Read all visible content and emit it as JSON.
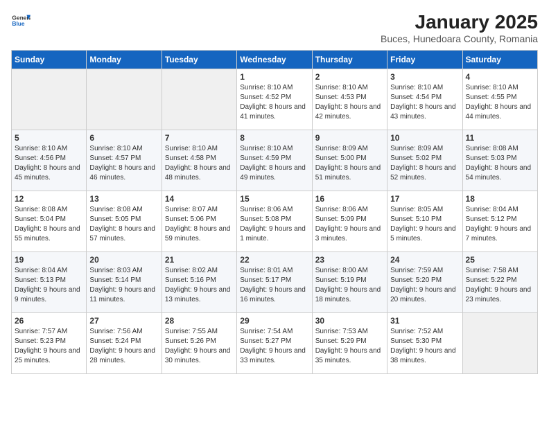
{
  "header": {
    "logo_general": "General",
    "logo_blue": "Blue",
    "title": "January 2025",
    "subtitle": "Buces, Hunedoara County, Romania"
  },
  "days_of_week": [
    "Sunday",
    "Monday",
    "Tuesday",
    "Wednesday",
    "Thursday",
    "Friday",
    "Saturday"
  ],
  "weeks": [
    [
      {
        "day": "",
        "sunrise": "",
        "sunset": "",
        "daylight": ""
      },
      {
        "day": "",
        "sunrise": "",
        "sunset": "",
        "daylight": ""
      },
      {
        "day": "",
        "sunrise": "",
        "sunset": "",
        "daylight": ""
      },
      {
        "day": "1",
        "sunrise": "Sunrise: 8:10 AM",
        "sunset": "Sunset: 4:52 PM",
        "daylight": "Daylight: 8 hours and 41 minutes."
      },
      {
        "day": "2",
        "sunrise": "Sunrise: 8:10 AM",
        "sunset": "Sunset: 4:53 PM",
        "daylight": "Daylight: 8 hours and 42 minutes."
      },
      {
        "day": "3",
        "sunrise": "Sunrise: 8:10 AM",
        "sunset": "Sunset: 4:54 PM",
        "daylight": "Daylight: 8 hours and 43 minutes."
      },
      {
        "day": "4",
        "sunrise": "Sunrise: 8:10 AM",
        "sunset": "Sunset: 4:55 PM",
        "daylight": "Daylight: 8 hours and 44 minutes."
      }
    ],
    [
      {
        "day": "5",
        "sunrise": "Sunrise: 8:10 AM",
        "sunset": "Sunset: 4:56 PM",
        "daylight": "Daylight: 8 hours and 45 minutes."
      },
      {
        "day": "6",
        "sunrise": "Sunrise: 8:10 AM",
        "sunset": "Sunset: 4:57 PM",
        "daylight": "Daylight: 8 hours and 46 minutes."
      },
      {
        "day": "7",
        "sunrise": "Sunrise: 8:10 AM",
        "sunset": "Sunset: 4:58 PM",
        "daylight": "Daylight: 8 hours and 48 minutes."
      },
      {
        "day": "8",
        "sunrise": "Sunrise: 8:10 AM",
        "sunset": "Sunset: 4:59 PM",
        "daylight": "Daylight: 8 hours and 49 minutes."
      },
      {
        "day": "9",
        "sunrise": "Sunrise: 8:09 AM",
        "sunset": "Sunset: 5:00 PM",
        "daylight": "Daylight: 8 hours and 51 minutes."
      },
      {
        "day": "10",
        "sunrise": "Sunrise: 8:09 AM",
        "sunset": "Sunset: 5:02 PM",
        "daylight": "Daylight: 8 hours and 52 minutes."
      },
      {
        "day": "11",
        "sunrise": "Sunrise: 8:08 AM",
        "sunset": "Sunset: 5:03 PM",
        "daylight": "Daylight: 8 hours and 54 minutes."
      }
    ],
    [
      {
        "day": "12",
        "sunrise": "Sunrise: 8:08 AM",
        "sunset": "Sunset: 5:04 PM",
        "daylight": "Daylight: 8 hours and 55 minutes."
      },
      {
        "day": "13",
        "sunrise": "Sunrise: 8:08 AM",
        "sunset": "Sunset: 5:05 PM",
        "daylight": "Daylight: 8 hours and 57 minutes."
      },
      {
        "day": "14",
        "sunrise": "Sunrise: 8:07 AM",
        "sunset": "Sunset: 5:06 PM",
        "daylight": "Daylight: 8 hours and 59 minutes."
      },
      {
        "day": "15",
        "sunrise": "Sunrise: 8:06 AM",
        "sunset": "Sunset: 5:08 PM",
        "daylight": "Daylight: 9 hours and 1 minute."
      },
      {
        "day": "16",
        "sunrise": "Sunrise: 8:06 AM",
        "sunset": "Sunset: 5:09 PM",
        "daylight": "Daylight: 9 hours and 3 minutes."
      },
      {
        "day": "17",
        "sunrise": "Sunrise: 8:05 AM",
        "sunset": "Sunset: 5:10 PM",
        "daylight": "Daylight: 9 hours and 5 minutes."
      },
      {
        "day": "18",
        "sunrise": "Sunrise: 8:04 AM",
        "sunset": "Sunset: 5:12 PM",
        "daylight": "Daylight: 9 hours and 7 minutes."
      }
    ],
    [
      {
        "day": "19",
        "sunrise": "Sunrise: 8:04 AM",
        "sunset": "Sunset: 5:13 PM",
        "daylight": "Daylight: 9 hours and 9 minutes."
      },
      {
        "day": "20",
        "sunrise": "Sunrise: 8:03 AM",
        "sunset": "Sunset: 5:14 PM",
        "daylight": "Daylight: 9 hours and 11 minutes."
      },
      {
        "day": "21",
        "sunrise": "Sunrise: 8:02 AM",
        "sunset": "Sunset: 5:16 PM",
        "daylight": "Daylight: 9 hours and 13 minutes."
      },
      {
        "day": "22",
        "sunrise": "Sunrise: 8:01 AM",
        "sunset": "Sunset: 5:17 PM",
        "daylight": "Daylight: 9 hours and 16 minutes."
      },
      {
        "day": "23",
        "sunrise": "Sunrise: 8:00 AM",
        "sunset": "Sunset: 5:19 PM",
        "daylight": "Daylight: 9 hours and 18 minutes."
      },
      {
        "day": "24",
        "sunrise": "Sunrise: 7:59 AM",
        "sunset": "Sunset: 5:20 PM",
        "daylight": "Daylight: 9 hours and 20 minutes."
      },
      {
        "day": "25",
        "sunrise": "Sunrise: 7:58 AM",
        "sunset": "Sunset: 5:22 PM",
        "daylight": "Daylight: 9 hours and 23 minutes."
      }
    ],
    [
      {
        "day": "26",
        "sunrise": "Sunrise: 7:57 AM",
        "sunset": "Sunset: 5:23 PM",
        "daylight": "Daylight: 9 hours and 25 minutes."
      },
      {
        "day": "27",
        "sunrise": "Sunrise: 7:56 AM",
        "sunset": "Sunset: 5:24 PM",
        "daylight": "Daylight: 9 hours and 28 minutes."
      },
      {
        "day": "28",
        "sunrise": "Sunrise: 7:55 AM",
        "sunset": "Sunset: 5:26 PM",
        "daylight": "Daylight: 9 hours and 30 minutes."
      },
      {
        "day": "29",
        "sunrise": "Sunrise: 7:54 AM",
        "sunset": "Sunset: 5:27 PM",
        "daylight": "Daylight: 9 hours and 33 minutes."
      },
      {
        "day": "30",
        "sunrise": "Sunrise: 7:53 AM",
        "sunset": "Sunset: 5:29 PM",
        "daylight": "Daylight: 9 hours and 35 minutes."
      },
      {
        "day": "31",
        "sunrise": "Sunrise: 7:52 AM",
        "sunset": "Sunset: 5:30 PM",
        "daylight": "Daylight: 9 hours and 38 minutes."
      },
      {
        "day": "",
        "sunrise": "",
        "sunset": "",
        "daylight": ""
      }
    ]
  ]
}
